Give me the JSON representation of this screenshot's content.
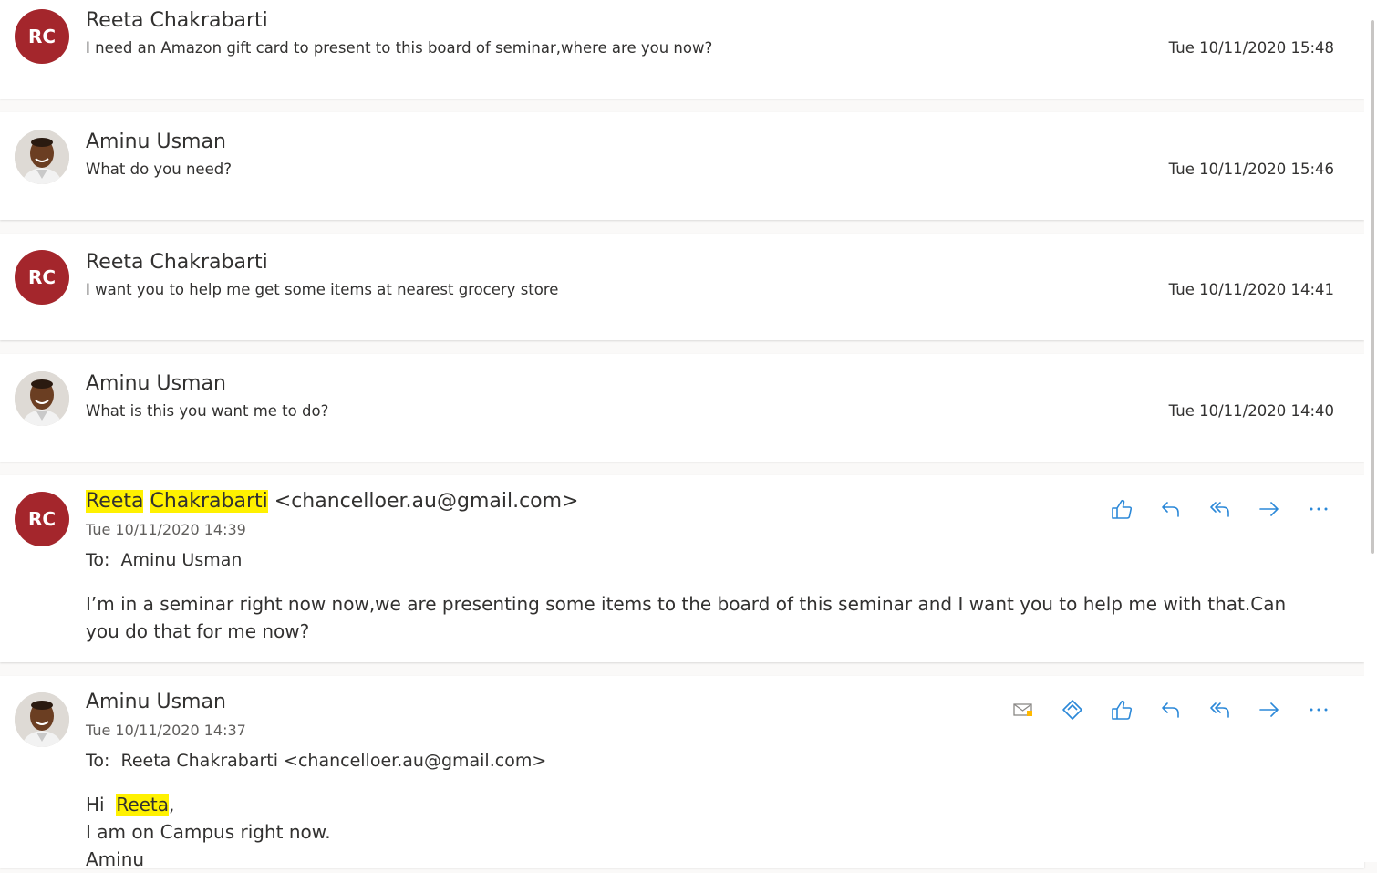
{
  "colors": {
    "accent": "#2b88d8",
    "avatar_rc": "#a4262c",
    "highlight": "#fff100"
  },
  "collapsed": [
    {
      "avatar_initials": "RC",
      "sender": "Reeta Chakrabarti",
      "preview": "I need an Amazon gift card to present to this board of seminar,where are you now?",
      "date": "Tue 10/11/2020 15:48"
    },
    {
      "avatar_initials": "",
      "sender": "Aminu Usman",
      "preview": "What do you need?",
      "date": "Tue 10/11/2020 15:46"
    },
    {
      "avatar_initials": "RC",
      "sender": "Reeta Chakrabarti",
      "preview": "I want you to help me get some items at nearest grocery store",
      "date": "Tue 10/11/2020 14:41"
    },
    {
      "avatar_initials": "",
      "sender": "Aminu Usman",
      "preview": "What is this you want me to do?",
      "date": "Tue 10/11/2020 14:40"
    }
  ],
  "expanded1": {
    "avatar_initials": "RC",
    "sender_first": "Reeta",
    "sender_last": "Chakrabarti",
    "sender_email": "<chancelloer.au@gmail.com>",
    "date": "Tue 10/11/2020 14:39",
    "to_label": "To:",
    "to_value": "Aminu Usman",
    "body": "I’m in a seminar right now now,we are presenting some items to the board of this seminar and I want you to help me with that.Can you do that for me now?",
    "icons": [
      "like-icon",
      "reply-icon",
      "reply-all-icon",
      "forward-icon",
      "more-icon"
    ]
  },
  "expanded2": {
    "sender": "Aminu Usman",
    "date": "Tue 10/11/2020 14:37",
    "to_label": "To:",
    "to_value": "Reeta Chakrabarti <chancelloer.au@gmail.com>",
    "greeting_hi": "Hi",
    "greeting_name": "Reeta",
    "greeting_comma": ",",
    "line2": "I am on Campus right now.",
    "line3": "Aminu",
    "icons": [
      "envelope-icon",
      "immersive-reader-icon",
      "like-icon",
      "reply-icon",
      "reply-all-icon",
      "forward-icon",
      "more-icon"
    ]
  }
}
